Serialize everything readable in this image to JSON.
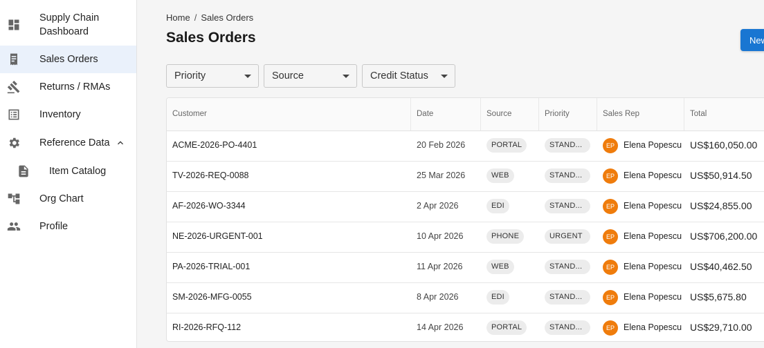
{
  "sidebar": {
    "items": [
      {
        "label": "Supply Chain",
        "label2": "Dashboard",
        "icon": "dashboard-icon"
      },
      {
        "label": "Sales Orders",
        "icon": "receipt-icon",
        "active": true
      },
      {
        "label": "Returns / RMAs",
        "icon": "gavel-icon"
      },
      {
        "label": "Inventory",
        "icon": "list-icon"
      },
      {
        "label": "Reference Data",
        "icon": "gear-icon",
        "expanded": true
      },
      {
        "label": "Item Catalog",
        "icon": "document-icon",
        "sub": true
      },
      {
        "label": "Org Chart",
        "icon": "org-chart-icon"
      },
      {
        "label": "Profile",
        "icon": "people-icon"
      }
    ]
  },
  "breadcrumb": {
    "home": "Home",
    "separator": "/",
    "current": "Sales Orders"
  },
  "page": {
    "title": "Sales Orders",
    "new_button": "New"
  },
  "filters": {
    "priority": "Priority",
    "source": "Source",
    "credit_status": "Credit Status"
  },
  "table": {
    "headers": {
      "customer": "Customer",
      "date": "Date",
      "source": "Source",
      "priority": "Priority",
      "sales_rep": "Sales Rep",
      "total": "Total"
    },
    "rows": [
      {
        "customer": "ACME-2026-PO-4401",
        "date": "20 Feb 2026",
        "source": "PORTAL",
        "priority": "STAND...",
        "rep_initials": "EP",
        "rep": "Elena Popescu",
        "total": "US$160,050.00"
      },
      {
        "customer": "TV-2026-REQ-0088",
        "date": "25 Mar 2026",
        "source": "WEB",
        "priority": "STAND...",
        "rep_initials": "EP",
        "rep": "Elena Popescu",
        "total": "US$50,914.50"
      },
      {
        "customer": "AF-2026-WO-3344",
        "date": "2 Apr 2026",
        "source": "EDI",
        "priority": "STAND...",
        "rep_initials": "EP",
        "rep": "Elena Popescu",
        "total": "US$24,855.00"
      },
      {
        "customer": "NE-2026-URGENT-001",
        "date": "10 Apr 2026",
        "source": "PHONE",
        "priority": "URGENT",
        "rep_initials": "EP",
        "rep": "Elena Popescu",
        "total": "US$706,200.00"
      },
      {
        "customer": "PA-2026-TRIAL-001",
        "date": "11 Apr 2026",
        "source": "WEB",
        "priority": "STAND...",
        "rep_initials": "EP",
        "rep": "Elena Popescu",
        "total": "US$40,462.50"
      },
      {
        "customer": "SM-2026-MFG-0055",
        "date": "8 Apr 2026",
        "source": "EDI",
        "priority": "STAND...",
        "rep_initials": "EP",
        "rep": "Elena Popescu",
        "total": "US$5,675.80"
      },
      {
        "customer": "RI-2026-RFQ-112",
        "date": "14 Apr 2026",
        "source": "PORTAL",
        "priority": "STAND...",
        "rep_initials": "EP",
        "rep": "Elena Popescu",
        "total": "US$29,710.00"
      }
    ]
  },
  "colors": {
    "accent": "#1976d2",
    "avatar": "#ef7c0c",
    "active_nav": "#eaf1fb"
  }
}
